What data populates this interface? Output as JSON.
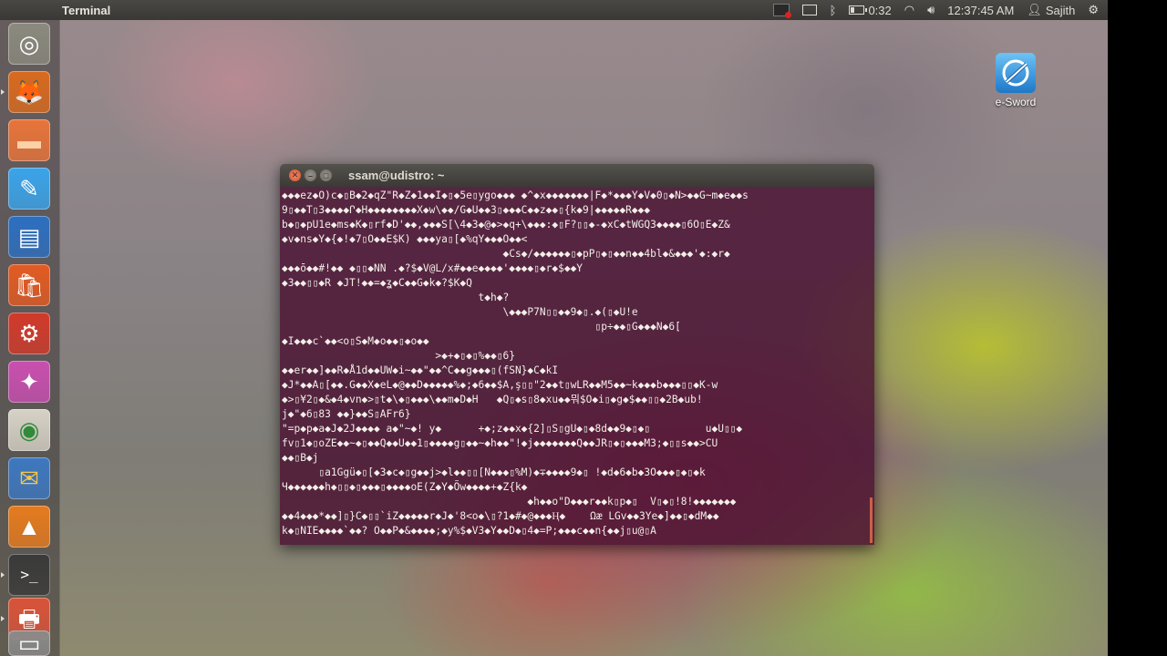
{
  "top_panel": {
    "app_title": "Terminal",
    "battery_time": "0:32",
    "clock": "12:37:45 AM",
    "user_name": "Sajith"
  },
  "launcher": {
    "items": [
      {
        "name": "ubuntu-dash-icon",
        "glyph": "◎",
        "bg": "#8b8a7e",
        "color": "#ffffff"
      },
      {
        "name": "firefox-icon",
        "glyph": "🦊",
        "bg": "#d96a1e",
        "color": "#ffffff"
      },
      {
        "name": "files-icon",
        "glyph": "▬",
        "bg": "#e8743a",
        "color": "#fbd1a8"
      },
      {
        "name": "e-sword-icon",
        "glyph": "✎",
        "bg": "#3aa4ea",
        "color": "#ffffff"
      },
      {
        "name": "writer-icon",
        "glyph": "▤",
        "bg": "#2c6fc0",
        "color": "#ffffff"
      },
      {
        "name": "software-center-icon",
        "glyph": "🛍",
        "bg": "#e35b22",
        "color": "#ffffff"
      },
      {
        "name": "settings-icon",
        "glyph": "⚙",
        "bg": "#d23a2a",
        "color": "#ffffff"
      },
      {
        "name": "video-editor-icon",
        "glyph": "✦",
        "bg": "#c94fb0",
        "color": "#ffffff"
      },
      {
        "name": "chrome-icon",
        "glyph": "◉",
        "bg": "#d7d2c6",
        "color": "#2f8a3a"
      },
      {
        "name": "thunderbird-icon",
        "glyph": "✉",
        "bg": "#3d78c0",
        "color": "#f6c646"
      },
      {
        "name": "vlc-icon",
        "glyph": "▲",
        "bg": "#e67b1e",
        "color": "#ffffff"
      },
      {
        "name": "terminal-icon",
        "glyph": ">_",
        "bg": "#3a3a3a",
        "color": "#ffffff"
      },
      {
        "name": "printer-icon",
        "glyph": "🖶",
        "bg": "#d9533a",
        "color": "#ffffff"
      },
      {
        "name": "drive-icon",
        "glyph": "▭",
        "bg": "#8a8a8a",
        "color": "#ffffff"
      }
    ]
  },
  "desktop": {
    "icons": [
      {
        "label": "e-Sword"
      }
    ]
  },
  "terminal": {
    "title": "ssam@udistro: ~",
    "lines": [
      "◆◆◆ez◆O)c◆▯B◆2◆qZ\"R◆Z◆1◆◆I◆▯◆5e▯ygo◆◆◆ ◆^◆x◆◆◆◆◆◆◆|F◆*◆◆◆Y◆V◆0▯◆N>◆◆G~m◆e◆◆s",
      "9▯◆◆T▯3◆◆◆◆Ր◆H◆◆◆◆◆◆◆◆X◆w\\◆◆/G◆U◆◆3▯◆◆◆C◆◆z◆◆▯{k◆9|◆◆◆◆◆R◆◆◆",
      "b◆▯◆pU1e◆ms◆K◆▯rf◆D'◆◆,◆◆◆S[\\4◆3◆@◆>◆q+\\◆◆◆:◆▯F?▯▯◆-◆xC◆tWGQ3◆◆◆◆▯6O▯E◆Z&",
      "◆v◆ns◆Y◆{◆!◆7▯O◆◆E$K) ◆◆◆ya▯[◆%qY◆◆◆O◆◆<",
      "                                    ◆Cs◆/◆◆◆◆◆◆▯◆pP▯◆▯◆◆n◆◆4bl◆&◆◆◆'◆:◆r◆",
      "◆◆◆ō◆◆#!◆◆ ◆▯▯◆NN .◆?$◆V@L/x#◆◆e◆◆◆◆'◆◆◆◆▯◆r◆$◆◆Y",
      "◆3◆◆▯▯◆R ◆JT!◆◆=◆ʓ◆C◆◆G◆k◆?$K◆Q",
      "                                t◆h◆?",
      "                                    \\◆◆◆P7N▯▯◆◆9◆▯.◆(▯◆U!e",
      "                                                   ▯p÷◆◆▯G◆◆◆N◆6[",
      "◆I◆◆◆c`◆◆<o▯S◆M◆o◆◆▯◆o◆◆",
      "                         >◆+◆▯◆▯%◆◆▯6}",
      "◆◆er◆◆]◆◆R◆Å1d◆◆UW◆i~◆◆\"◆◆^C◆◆g◆◆◆▯(fSN}◆C◆kI",
      "◆J*◆◆A▯[◆◆.G◆◆X◆eL◆@◆◆D◆◆◆◆◆%◆;◆6◆◆$A,ş▯▯\"2◆◆t▯wLR◆◆M5◆◆~k◆◆◆b◆◆◆▯▯◆K-w",
      "◆>▯¥2▯◆&◆4◆vn◆>▯t◆\\◆▯◆◆◆\\◆◆m◆D◆H   ◆Q▯◆s▯8◆xu◆◆뭐$O◆i▯◆g◆$◆◆▯▯◆2B◆ub!",
      "j◆\"◆6▯83 ◆◆}◆◆S▯AFr6}",
      "\"=p◆p◆a◆J◆2J◆◆◆◆ a◆\"~◆! y◆      +◆;z◆◆x◆{2]▯S▯gU◆▯◆8d◆◆9◆▯◆▯         u◆U▯▯◆",
      "fv▯1◆▯oZE◆◆~◆▯◆◆Q◆◆U◆◆1▯◆◆◆◆g▯◆◆~◆h◆◆\"!◆j◆◆◆◆◆◆◆Q◆◆JR▯◆▯◆◆◆M3;◆▯▯s◆◆>CU",
      "◆◆▯B◆j",
      "      ▯a1Ggü◆▯[◆3◆c◆▯g◆◆j>◆l◆◆▯▯[N◆◆◆▯%M)◆∓◆◆◆◆9◆▯ !◆d◆6◆b◆3O◆◆◆▯◆▯◆k",
      "Ч◆◆◆◆◆◆h◆▯▯◆▯◆◆◆▯◆◆◆◆oE(Z◆Y◆Õw◆◆◆◆+◆Z{k◆",
      "                                        ◆h◆◆o\"D◆◆◆r◆◆k▯p◆▯  V▯◆▯!8!◆◆◆◆◆◆◆",
      "◆◆4◆◆◆*◆◆]▯}C◆▯▯`iZ◆◆◆◆◆r◆J◆'8<o◆\\▯?1◆#◆@◆◆◆Ⱨ◆    Ωæ LGv◆◆3Ye◆]◆◆▯◆dM◆◆",
      "k◆▯NIE◆◆◆◆`◆◆? O◆◆P◆&◆◆◆◆;◆y%$◆V3◆Y◆◆D◆▯4◆=P;◆◆◆c◆◆n{◆◆j▯u@▯A"
    ]
  }
}
